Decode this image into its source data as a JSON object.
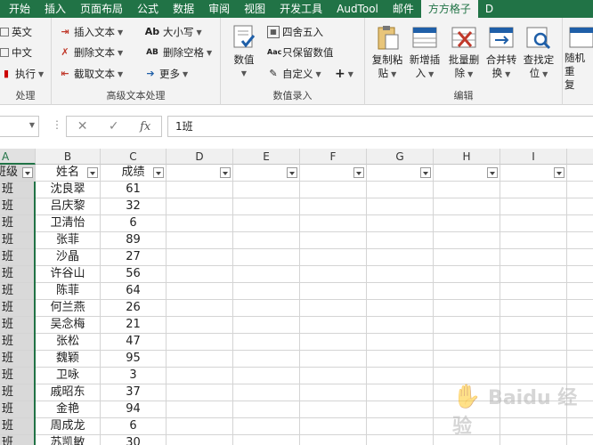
{
  "tabs": [
    "开始",
    "插入",
    "页面布局",
    "公式",
    "数据",
    "审阅",
    "视图",
    "开发工具",
    "AudTool",
    "邮件",
    "方方格子",
    "D"
  ],
  "active_tab": "方方格子",
  "ribbon": {
    "group1": {
      "items": [
        "英文",
        "中文",
        "执行"
      ],
      "label": "处理"
    },
    "group2": {
      "items": [
        "插入文本",
        "删除文本",
        "截取文本",
        "大小写",
        "删除空格",
        "更多"
      ],
      "label": "高级文本处理"
    },
    "group3": {
      "number_button": "数值",
      "items": [
        "四舍五入",
        "只保留数值",
        "自定义"
      ],
      "plus": "+",
      "label": "数值录入"
    },
    "group4": {
      "buttons": [
        {
          "line1": "复制粘",
          "line2": "贴"
        },
        {
          "line1": "新增插",
          "line2": "入"
        },
        {
          "line1": "批量删",
          "line2": "除"
        },
        {
          "line1": "合并转",
          "line2": "换"
        },
        {
          "line1": "查找定",
          "line2": "位"
        }
      ],
      "label": "编辑"
    },
    "group5": {
      "line1": "随机重",
      "line2": "复"
    }
  },
  "formula_bar": {
    "fx": "fx",
    "cancel": "✕",
    "confirm": "✓",
    "value": "1班"
  },
  "columns": [
    "A",
    "B",
    "C",
    "D",
    "E",
    "F",
    "G",
    "H",
    "I"
  ],
  "table": {
    "headers": [
      "班级",
      "姓名",
      "成绩"
    ],
    "rows": [
      [
        "班",
        "沈良翠",
        "61"
      ],
      [
        "班",
        "吕庆黎",
        "32"
      ],
      [
        "班",
        "卫清怡",
        "6"
      ],
      [
        "班",
        "张菲",
        "89"
      ],
      [
        "班",
        "沙晶",
        "27"
      ],
      [
        "班",
        "许谷山",
        "56"
      ],
      [
        "班",
        "陈菲",
        "64"
      ],
      [
        "班",
        "何兰燕",
        "26"
      ],
      [
        "班",
        "吴念梅",
        "21"
      ],
      [
        "班",
        "张松",
        "47"
      ],
      [
        "班",
        "魏颖",
        "95"
      ],
      [
        "班",
        "卫咏",
        "3"
      ],
      [
        "班",
        "戚昭东",
        "37"
      ],
      [
        "班",
        "金艳",
        "94"
      ],
      [
        "班",
        "周成龙",
        "6"
      ],
      [
        "班",
        "苏凯敏",
        "30"
      ]
    ]
  },
  "watermark": "Baidu 经验",
  "colors": {
    "accent": "#217346",
    "header_bg": "#f0f0f0",
    "selected_col": "#d9d9d9"
  }
}
